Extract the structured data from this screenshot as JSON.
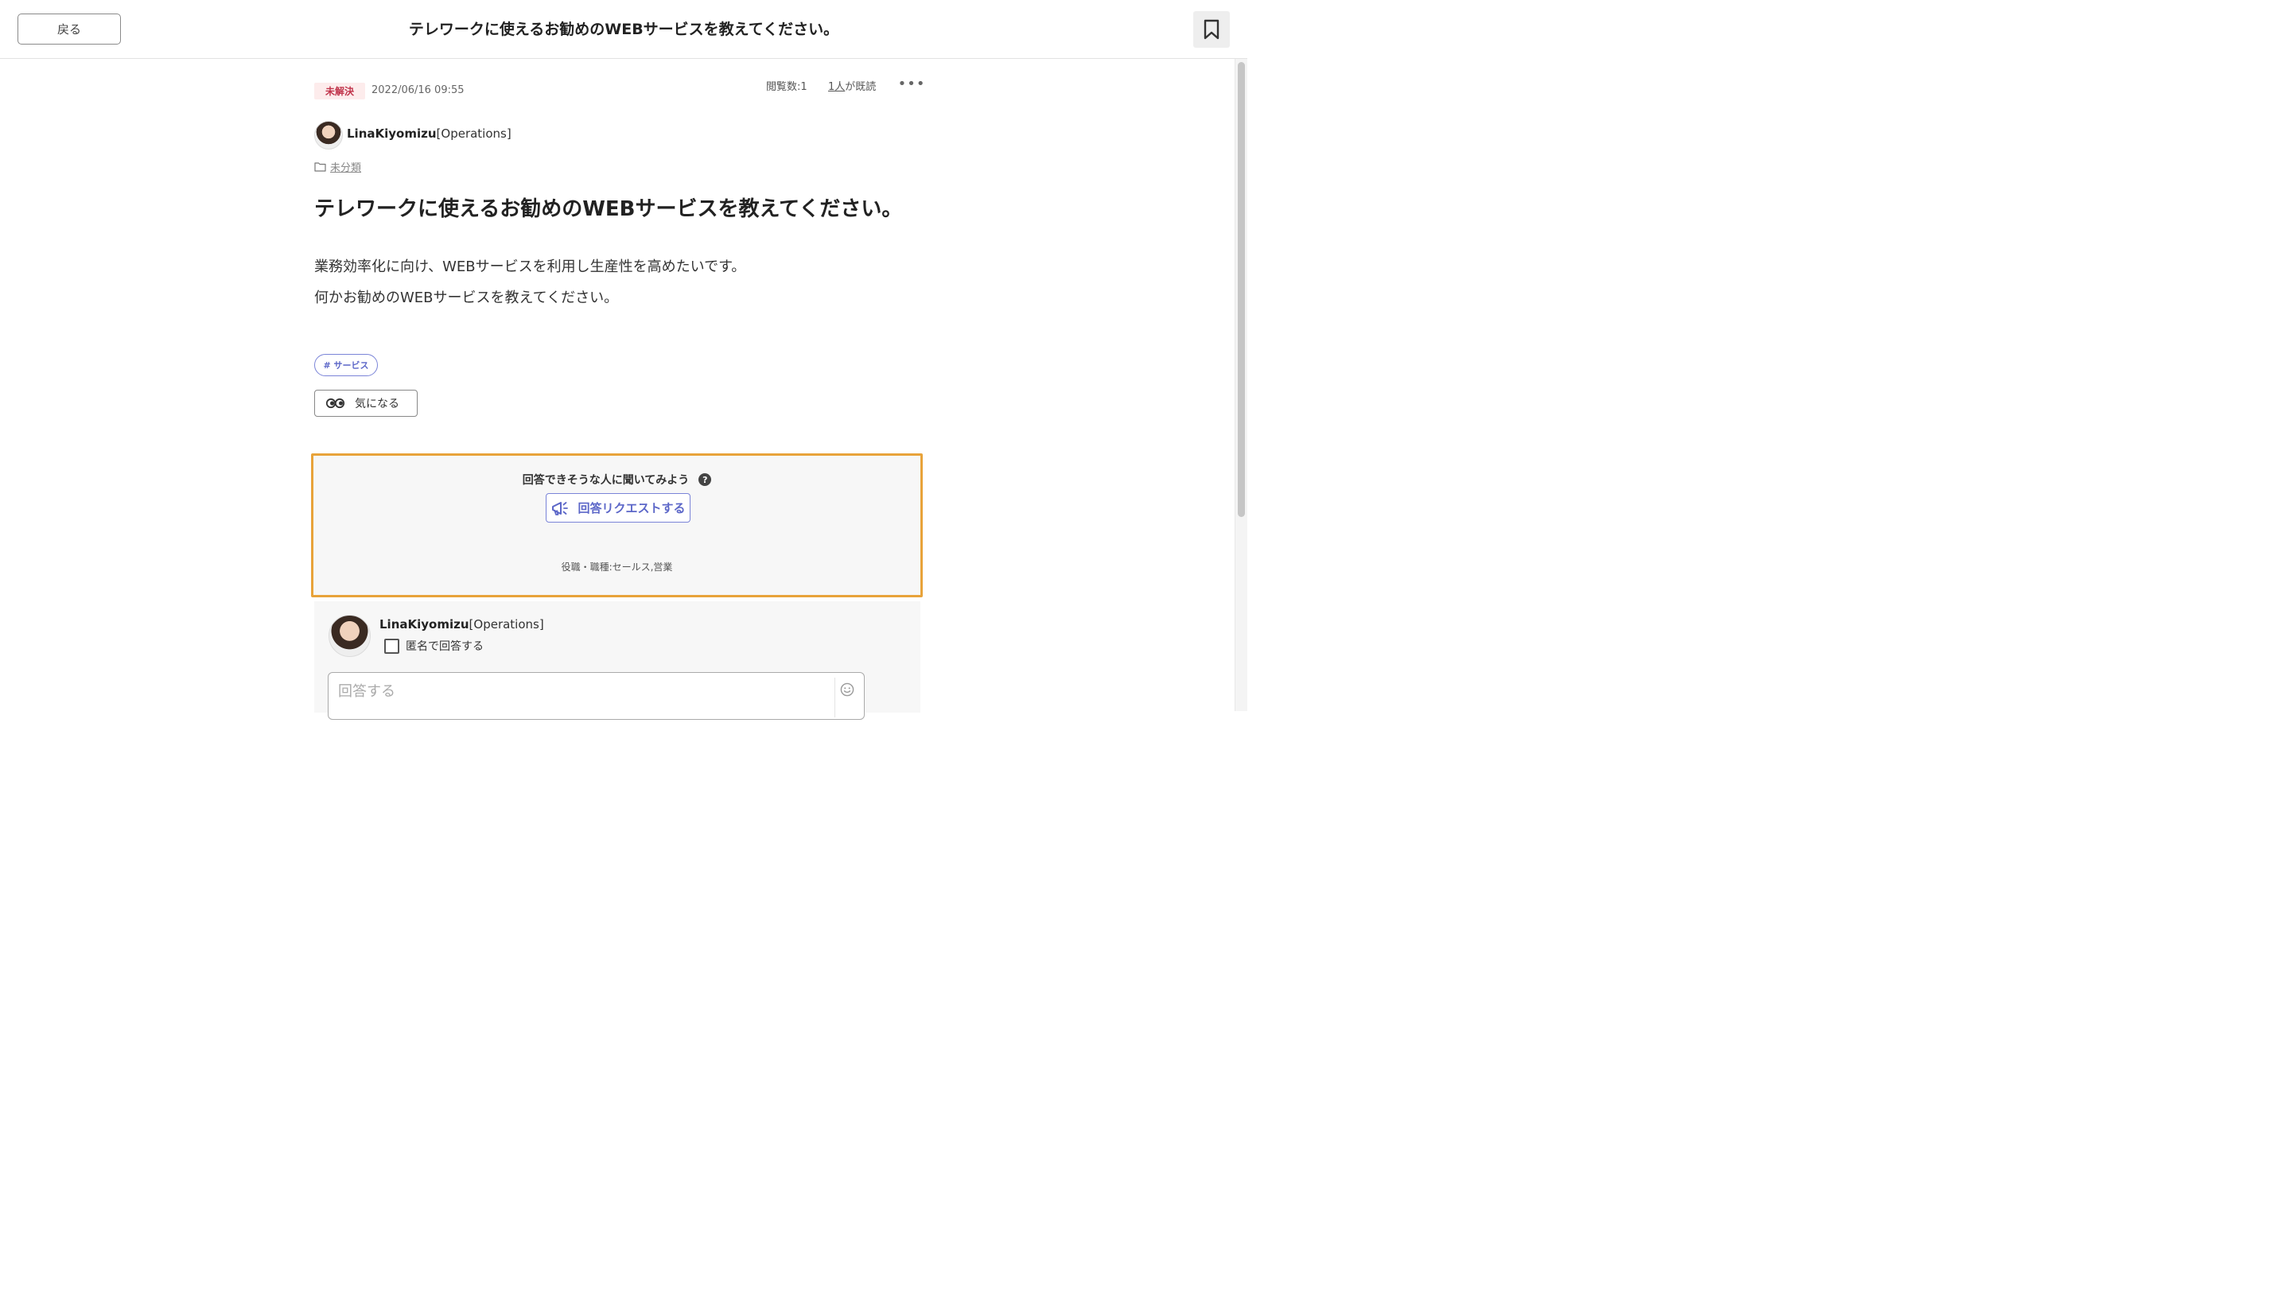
{
  "header": {
    "back_label": "戻る",
    "title": "テレワークに使えるお勧めのWEBサービスを教えてください。",
    "bookmark_icon": "bookmark-icon"
  },
  "post": {
    "status": "未解決",
    "date": "2022/06/16 09:55",
    "views": "閲覧数:1",
    "read_count": "1人",
    "read_suffix": "が既読",
    "more_label": "•••",
    "author_name": "LinaKiyomizu",
    "author_dept": "[Operations]",
    "category": "未分類",
    "title": "テレワークに使えるお勧めのWEBサービスを教えてください。",
    "body_line1": "業務効率化に向け、WEBサービスを利用し生産性を高めたいです。",
    "body_line2": "何かお勧めのWEBサービスを教えてください。",
    "tag": "# サービス",
    "interest_label": "気になる"
  },
  "request_box": {
    "heading": "回答できそうな人に聞いてみよう",
    "help_glyph": "?",
    "button_label": "回答リクエストする",
    "role": "役職・職種:セールス,営業"
  },
  "answer": {
    "author_name": "LinaKiyomizu",
    "author_dept": "[Operations]",
    "anonymous_label": "匿名で回答する",
    "placeholder": "回答する"
  },
  "colors": {
    "accent": "#5c67c8",
    "status_red": "#c0334a",
    "highlight_border": "#e8a33a"
  }
}
